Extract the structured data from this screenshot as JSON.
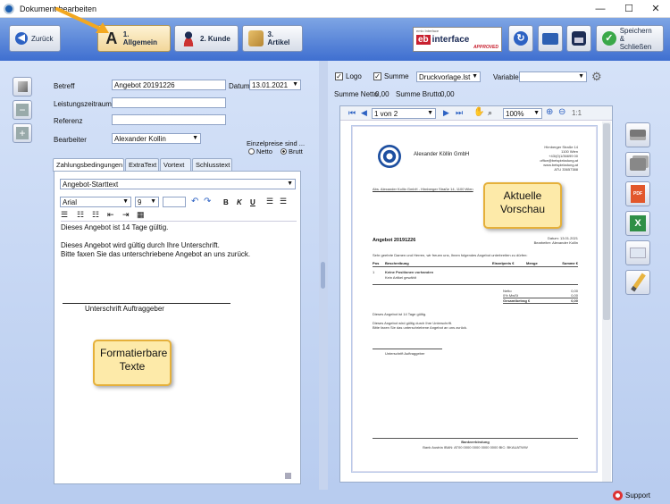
{
  "window": {
    "title": "Dokument bearbeiten",
    "minimize": "—",
    "maximize": "☐",
    "close": "✕"
  },
  "toolbar": {
    "back_label": "Zurück",
    "tabs": [
      {
        "label": "1. Allgemein",
        "glyph": "A"
      },
      {
        "label": "2. Kunde"
      },
      {
        "label": "3. Artikel"
      }
    ],
    "logo_text_left": "eb",
    "logo_text_right": "interface",
    "logo_approved": "APPROVED",
    "logo_small": "emic Interface",
    "save_label_1": "Speichern",
    "save_label_2": "& Schließen",
    "colors": {
      "active_tab": "#f2d79a",
      "toolbar_top": "#7ea5e4",
      "toolbar_bottom": "#3f6fd0"
    }
  },
  "form": {
    "betreff_label": "Betreff",
    "betreff_value": "Angebot 20191226",
    "datum_label": "Datum",
    "datum_value": "13.01.2021",
    "leistungszeitraum_label": "Leistungszeitraum",
    "referenz_label": "Referenz",
    "bearbeiter_label": "Bearbeiter",
    "bearbeiter_value": "Alexander Kollin",
    "einzelpreise_label": "Einzelpreise sind ...",
    "netto_label": "Netto",
    "brutto_label": "Brutt"
  },
  "text_tabs": [
    "Zahlungsbedingungen",
    "ExtraText",
    "Vortext",
    "Schlusstext"
  ],
  "editor": {
    "template_value": "Angebot-Starttext",
    "font_value": "Arial",
    "size_value": "9",
    "lines": [
      "Dieses Angebot ist 14 Tage gültig.",
      "",
      "Dieses Angebot wird gültig durch Ihre Unterschrift.",
      "Bitte faxen Sie das unterschriebene Angebot an uns zurück."
    ],
    "signature_label": "Unterschrift Auftraggeber"
  },
  "callouts": {
    "left_line1": "Formatierbare",
    "left_line2": "Texte",
    "right_line1": "Aktuelle",
    "right_line2": "Vorschau"
  },
  "preview_options": {
    "logo_label": "Logo",
    "summe_label": "Summe",
    "template_value": "Druckvorlage.lst",
    "variable_label": "Variable",
    "summe_netto_label": "Summe Netto",
    "summe_netto_value": "0,00",
    "summe_brutto_label": "Summe Brutto",
    "summe_brutto_value": "0,00"
  },
  "viewer": {
    "page_value": "1 von 2",
    "zoom_value": "100%",
    "scale_label": "1:1"
  },
  "document": {
    "company": "Alexander Köllin GmbH",
    "address_lines": [
      "Hirnberger Straße 14",
      "1100 Wien",
      "+43/(0)1/36699 00",
      "office@beispieladung.at",
      "www.beispieladung.at",
      "ATU 33657388"
    ],
    "sender_line": "Abs. Alexander Kollin GmbH - Hirnberger Straße 14, 1100 Wien",
    "doc_title": "Angebot 20191226",
    "datum_line": "Datum: 13.01.2021",
    "bearbeiter_line": "Bearbeiter: Alexander Kollin",
    "intro_line": "Sehr geehrte Damen und Herren, wir freuen uns, Ihnen folgendes Angebot unterbreiten zu dürfen:",
    "table_headers": [
      "Pos",
      "Beschreibung",
      "Einzelpreis €",
      "Menge",
      "Summe €"
    ],
    "row_pos": "1",
    "row_desc_1": "Keine Positionen vorhanden",
    "row_desc_2": "Kein Artikel gewählt",
    "totals": [
      {
        "label": "Netto",
        "value": "0,00"
      },
      {
        "label": "0% MwSt",
        "value": "0,00"
      },
      {
        "label": "Gesamtbetrag €",
        "value": "0,00"
      }
    ],
    "body_lines": [
      "Dieses Angebot ist 14 Tage gültig.",
      "",
      "Dieses Angebot wird gültig durch Ihre Unterschrift.",
      "Bitte faxen Sie das unterschriebene Angebot an uns zurück."
    ],
    "signature": "Unterschrift Auftraggeber",
    "footer_title": "Bankverbindung",
    "footer_line": "Bank Austria  IBAN: AT00 0000 0000 0000 0000  BIC: BKAUATWW"
  },
  "status": {
    "support_label": "Support"
  }
}
